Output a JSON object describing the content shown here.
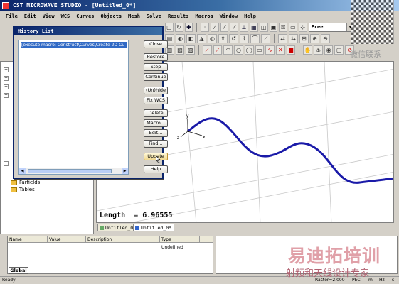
{
  "window": {
    "title": "CST MICROWAVE STUDIO - [Untitled_0*]"
  },
  "menu": [
    "File",
    "Edit",
    "View",
    "WCS",
    "Curves",
    "Objects",
    "Mesh",
    "Solve",
    "Results",
    "Macros",
    "Window",
    "Help"
  ],
  "toolbar": {
    "mode_combo": "Free"
  },
  "tree": {
    "items": [
      "Farfields",
      "Tables"
    ]
  },
  "dialog": {
    "title": "History List",
    "history_entry": "[execute macro: Construct\\Curves\\Create 2D-Cu",
    "buttons": {
      "close": "Close",
      "restore": "Restore",
      "step": "Step",
      "continue": "Continue",
      "unhide": "(Un)hide",
      "fix_wcs": "Fix WCS",
      "delete": "Delete",
      "macro": "Macro...",
      "edit": "Edit...",
      "find": "Find...",
      "update": "Update",
      "help": "Help"
    }
  },
  "viewport": {
    "length_label": "Length",
    "length_value": "6.96555",
    "tabs": [
      "Untitled_0*",
      "Untitled_0*"
    ],
    "axis_labels": {
      "y": "y",
      "z": "z",
      "x": "x"
    }
  },
  "parameters": {
    "columns": [
      "Name",
      "Value",
      "Description",
      "Type"
    ],
    "type_value": "Undefined",
    "tab": "Global"
  },
  "status": {
    "left": "Ready",
    "raster": "Raster=2.000",
    "pec": "PEC",
    "m": "m",
    "hz": "Hz",
    "s": "s"
  },
  "watermark": {
    "top": "微信联系",
    "main": "易迪拓培训",
    "sub": "射频和天线设计专家"
  },
  "colors": {
    "curve": "#1a1aa8",
    "title_bar": "#0a246a"
  }
}
